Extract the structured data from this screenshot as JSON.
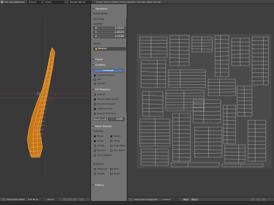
{
  "topbar": {
    "menu": [
      "File",
      "Render",
      "Window",
      "Help"
    ],
    "layout_name": "Default",
    "scene_name": "Scene",
    "render_engine": "Blender Render",
    "stats": "v2.69 | Verts:144/384 | Faces:142/383 | Tris:384 | Mem:19.21M"
  },
  "properties": {
    "sections": {
      "transform": "Transform",
      "origin": "Origin",
      "shading": "Shading",
      "uv_mapping": "UV Mapping",
      "mesh_display": "Mesh Display",
      "history": "History"
    },
    "view_mode": "Vertex Mode",
    "3d_cursor": "3D Cursor",
    "location": {
      "title": "Location",
      "x": {
        "label": "X:",
        "value": "0.33167"
      },
      "y": {
        "label": "Y:",
        "value": "-0.00229"
      },
      "z": {
        "label": "Z:",
        "value": "0.34789"
      }
    },
    "object": {
      "label": "Object",
      "value": "Medium"
    },
    "shading_items": {
      "buttons": [
        "Multiblast",
        "Smooth Shading"
      ],
      "items": [
        "Flat",
        "Smooth"
      ]
    },
    "uv_items": [
      "Unwrap",
      "Follow Active Quads",
      "Smart UV Project",
      "Lightmap Pack",
      "Project From View"
    ],
    "pin": {
      "label": "Pin Data",
      "value": "0.000"
    },
    "overlays": {
      "title": "Overlays",
      "items": [
        {
          "label": "Faces",
          "on": true
        },
        {
          "label": "Seams",
          "on": true
        },
        {
          "label": "Edges",
          "on": true
        },
        {
          "label": "Sharp",
          "on": false
        },
        {
          "label": "Crease",
          "on": false
        },
        {
          "label": "Edge Marks",
          "on": false
        },
        {
          "label": "Normals",
          "on": false
        },
        {
          "label": "Face Marks",
          "on": false
        }
      ],
      "extra": "Show Weights"
    },
    "info": {
      "title": "Numerics",
      "items": [
        {
          "label": "Edge Info",
          "on": false
        },
        {
          "label": "Area",
          "on": false
        },
        {
          "label": "Length",
          "on": false
        },
        {
          "label": "Angle",
          "on": false
        }
      ]
    }
  },
  "viewport_header": {
    "menus": [
      "View",
      "Select",
      "Mesh"
    ],
    "mode": "Edit Mode",
    "pivot": "Global"
  },
  "uv_header": {
    "menus": [
      "View",
      "Select",
      "Image",
      "UVs"
    ],
    "image_name": "Untitled",
    "buttons": [
      "New",
      "Open"
    ]
  },
  "colors": {
    "mesh_orange": "#e8901c",
    "mesh_highlight": "#ffc04a",
    "x_axis": "#b33a3a",
    "y_axis": "#6a9a2a",
    "uv_wire": "#d8d8d8",
    "panel_bg": "#727272",
    "accent_blue": "#5680c2"
  }
}
